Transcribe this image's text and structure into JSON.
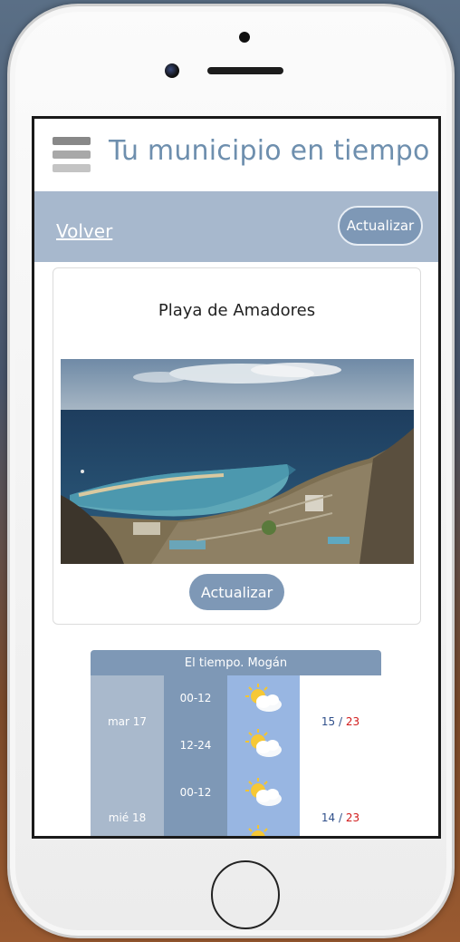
{
  "app": {
    "title": "Tu municipio en tiempo ..."
  },
  "nav": {
    "back_label": "Volver",
    "refresh_label": "Actualizar"
  },
  "webcam": {
    "title": "Playa de Amadores",
    "refresh_label": "Actualizar"
  },
  "weather": {
    "header": "El tiempo. Mogán",
    "days": [
      {
        "label": "mar 17",
        "periods": [
          {
            "label": "00-12",
            "icon": "sun-cloud-icon"
          },
          {
            "label": "12-24",
            "icon": "sun-cloud-icon"
          }
        ],
        "min": "15",
        "max": "23"
      },
      {
        "label": "mié 18",
        "periods": [
          {
            "label": "00-12",
            "icon": "sun-cloud-icon"
          },
          {
            "label": "",
            "icon": "sun-cloud-icon"
          }
        ],
        "min": "14",
        "max": "23"
      }
    ],
    "separator": " / ",
    "colors": {
      "min": "#2f4f8a",
      "max": "#d11a1a"
    }
  },
  "colors": {
    "accent": "#7e98b6",
    "subbar": "#a7b8cd",
    "title": "#6e8fae"
  }
}
